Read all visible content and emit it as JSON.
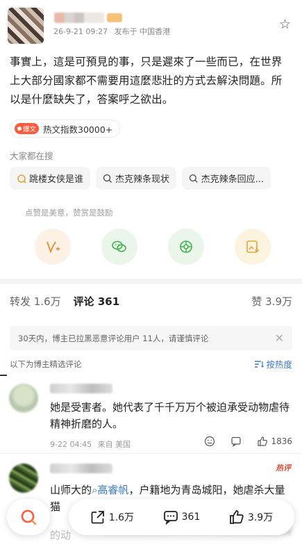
{
  "post": {
    "timestamp": "26-9-21 09:27",
    "published_from": "发布于 中国香港",
    "body": "事實上，這是可預見的事，只是遲來了一些而已，在世界上大部分國家都不需要用這麼悲壯的方式去解決問題。所以是什麼缺失了，答案呼之欲出。",
    "hot_tag_pill": "爆文",
    "hot_index": "热文指数30000+"
  },
  "search": {
    "title": "大家都在搜",
    "chips": [
      "跳楼女侠是谁",
      "杰克辣条现状",
      "杰克辣条回应..."
    ]
  },
  "reward": {
    "hint": "点赞是美意，赞赏是鼓励"
  },
  "tabs": {
    "repost": "转发 1.6万",
    "comments": "评论 361",
    "likes": "赞 3.9万"
  },
  "notice": {
    "text": "30天内，博主已拉黑恶意评论用户 11人，请谨慎评论"
  },
  "filter": {
    "label": "以下为博主精选评论",
    "sort": "按热度"
  },
  "comments": [
    {
      "text": "她是受害者。她代表了千千万万个被迫承受动物虐待精神折磨的人。",
      "date": "9-22 04:45",
      "location": "来自 美国",
      "likes": "1836"
    },
    {
      "hot_label": "热评",
      "text_before": "山师大的",
      "link_text": "高睿帆",
      "text_after": "，户籍地为青岛城阳，她虐杀大量猫",
      "text_tail": "的动"
    }
  ],
  "bottom_bar": {
    "reposts": "1.6万",
    "comments": "361",
    "likes": "3.9万"
  },
  "colors": {
    "accent_red": "#ff5a3c",
    "link_blue": "#3b7ac9",
    "hot_red": "#e04d3a"
  }
}
